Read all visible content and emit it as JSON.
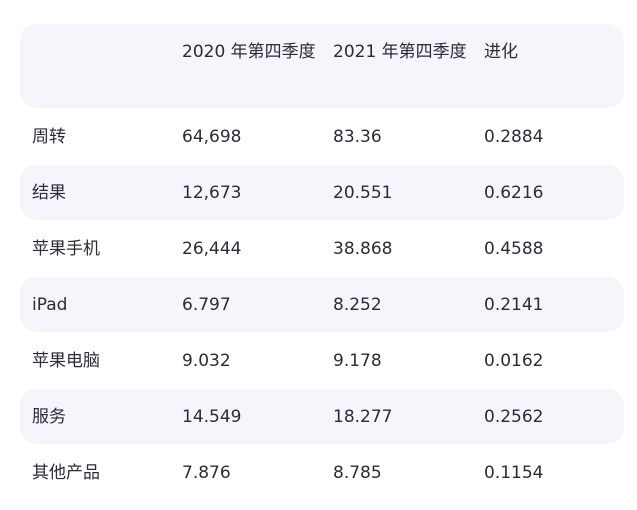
{
  "table": {
    "headers": [
      "",
      "2020 年第四季度",
      "2021 年第四季度",
      "进化"
    ],
    "rows": [
      {
        "label": "周转",
        "q4_2020": "64,698",
        "q4_2021": "83.36",
        "change": "0.2884"
      },
      {
        "label": "结果",
        "q4_2020": "12,673",
        "q4_2021": "20.551",
        "change": "0.6216"
      },
      {
        "label": "苹果手机",
        "q4_2020": "26,444",
        "q4_2021": "38.868",
        "change": "0.4588"
      },
      {
        "label": "iPad",
        "q4_2020": "6.797",
        "q4_2021": "8.252",
        "change": "0.2141"
      },
      {
        "label": "苹果电脑",
        "q4_2020": "9.032",
        "q4_2021": "9.178",
        "change": "0.0162"
      },
      {
        "label": "服务",
        "q4_2020": "14.549",
        "q4_2021": "18.277",
        "change": "0.2562"
      },
      {
        "label": "其他产品",
        "q4_2020": "7.876",
        "q4_2021": "8.785",
        "change": "0.1154"
      }
    ]
  },
  "colors": {
    "row_shade": "#f5f5fc",
    "text": "#2b2b3a"
  }
}
